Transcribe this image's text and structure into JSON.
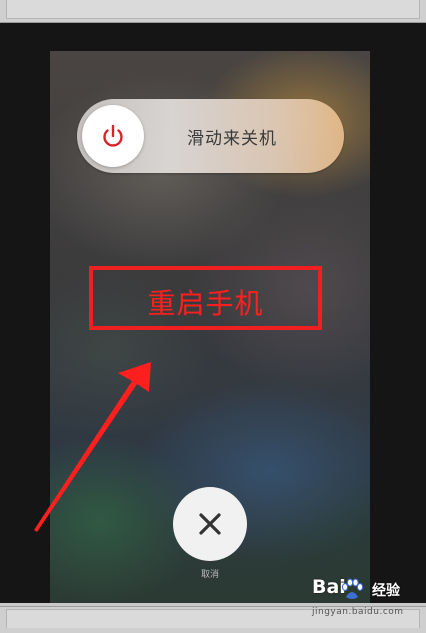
{
  "power_off_slider": {
    "label": "滑动来关机",
    "icon": "power-icon",
    "accent_color": "#d8232a"
  },
  "cancel": {
    "label": "取消",
    "icon": "close-icon"
  },
  "annotation": {
    "label": "重启手机",
    "color": "#f02020"
  },
  "watermark": {
    "brand_left": "Bai",
    "brand_right": "经验",
    "url": "jingyan.baidu.com"
  }
}
